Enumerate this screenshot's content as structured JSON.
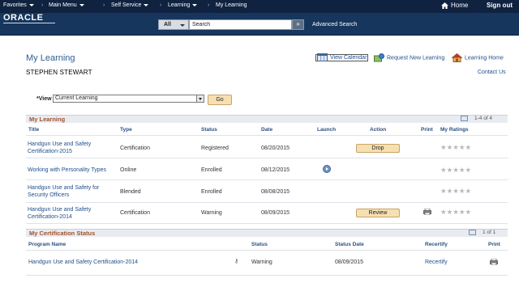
{
  "topnav": {
    "favorites": "Favorites",
    "main_menu": "Main Menu",
    "self_service": "Self Service",
    "learning": "Learning",
    "my_learning": "My Learning",
    "home": "Home",
    "sign_out": "Sign out"
  },
  "header": {
    "logo": "ORACLE",
    "search_scope": "All",
    "search_value": "Search",
    "advanced_search": "Advanced Search"
  },
  "page": {
    "title": "My Learning",
    "person": "STEPHEN STEWART",
    "view_calendar": "View Calendar",
    "request_new_learning": "Request New Learning",
    "learning_home": "Learning Home",
    "contact_us": "Contact Us"
  },
  "view": {
    "label": "*View",
    "selected": "Current Learning",
    "go": "Go"
  },
  "my_learning": {
    "title": "My Learning",
    "pagination": "1-4 of 4",
    "columns": [
      "Title",
      "Type",
      "Status",
      "Date",
      "Launch",
      "Action",
      "Print",
      "My Ratings"
    ],
    "rows": [
      {
        "title_line1": "Handgun Use and Safety",
        "title_line2": "Certification-2015",
        "type": "Certification",
        "status": "Registered",
        "date": "08/20/2015",
        "action": "Drop",
        "rating": "★★★★★"
      },
      {
        "title_line1": "Working with Personality Types",
        "title_line2": "",
        "type": "Online",
        "status": "Enrolled",
        "date": "08/12/2015",
        "action": "",
        "rating": "★★★★★"
      },
      {
        "title_line1": "Handgun Use and Safety for",
        "title_line2": "Security Officers",
        "type": "Blended",
        "status": "Enrolled",
        "date": "08/08/2015",
        "action": "",
        "rating": "★★★★★"
      },
      {
        "title_line1": "Handgun Use and Safety",
        "title_line2": "Certification-2014",
        "type": "Certification",
        "status": "Warning",
        "date": "08/09/2015",
        "action": "Review",
        "rating": "★★★★★"
      }
    ]
  },
  "certification": {
    "title": "My Certification Status",
    "pagination": "1 of 1",
    "columns": [
      "Program Name",
      "Status",
      "Status Date",
      "Recertify",
      "Print"
    ],
    "rows": [
      {
        "program": "Handgun Use and Safety Certification-2014",
        "status": "Warning",
        "status_date": "08/09/2015",
        "recertify": "Recertify"
      }
    ]
  }
}
